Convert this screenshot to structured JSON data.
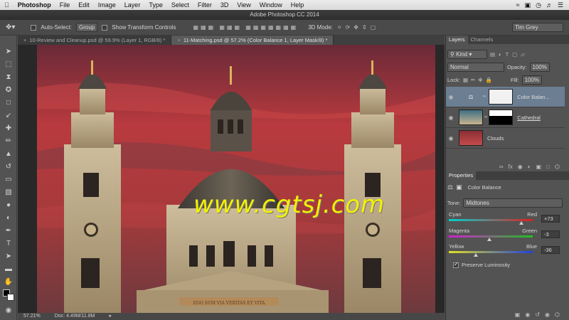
{
  "menubar": {
    "apple": "",
    "app": "Photoshop",
    "items": [
      "File",
      "Edit",
      "Image",
      "Layer",
      "Type",
      "Select",
      "Filter",
      "3D",
      "View",
      "Window",
      "Help"
    ],
    "right_icons": [
      "wifi-icon",
      "display-icon",
      "clock-icon",
      "volume-icon",
      "menu-icon"
    ]
  },
  "window": {
    "title": "Adobe Photoshop CC 2014"
  },
  "options": {
    "auto_select_label": "Auto-Select:",
    "auto_select_value": "Group",
    "transform_label": "Show Transform Controls",
    "mode_label": "3D Mode:",
    "workspace": "Tim Grey"
  },
  "tabs": [
    {
      "label": "10-Review and Cleanup.psd @ 59.9% (Layer 1, RGB/8) *",
      "active": false
    },
    {
      "label": "11-Matching.psd @ 57.2% (Color Balance 1, Layer Mask/8) *",
      "active": true
    }
  ],
  "canvas": {
    "watermark": "www.cgtsj.com",
    "inscription": "EGO SUM VIA VERITAS ET VITA"
  },
  "status": {
    "zoom": "57.21%",
    "doc": "Doc: 4.49M/11.8M"
  },
  "layers_panel": {
    "tabs": [
      "Layers",
      "Channels"
    ],
    "filter": "Kind",
    "blend": "Normal",
    "opacity_label": "Opacity:",
    "opacity": "100%",
    "lock_label": "Lock:",
    "fill_label": "Fill:",
    "fill": "100%",
    "layers": [
      {
        "name": "Color Balan...",
        "selected": true
      },
      {
        "name": "Cathedral",
        "selected": false
      },
      {
        "name": "Clouds",
        "selected": false
      }
    ]
  },
  "properties_panel": {
    "title": "Properties",
    "adjustment": "Color Balance",
    "tone_label": "Tone:",
    "tone_value": "Midtones",
    "sliders": [
      {
        "left": "Cyan",
        "right": "Red",
        "value": "+73",
        "level": 73
      },
      {
        "left": "Magenta",
        "right": "Green",
        "value": "-3",
        "level": -3
      },
      {
        "left": "Yellow",
        "right": "Blue",
        "value": "-36",
        "level": -36
      }
    ],
    "preserve_label": "Preserve Luminosity"
  },
  "colors": {
    "accent_selection": "#6b7e92",
    "watermark": "#f2f200",
    "sky_red": "#b83a3e"
  }
}
